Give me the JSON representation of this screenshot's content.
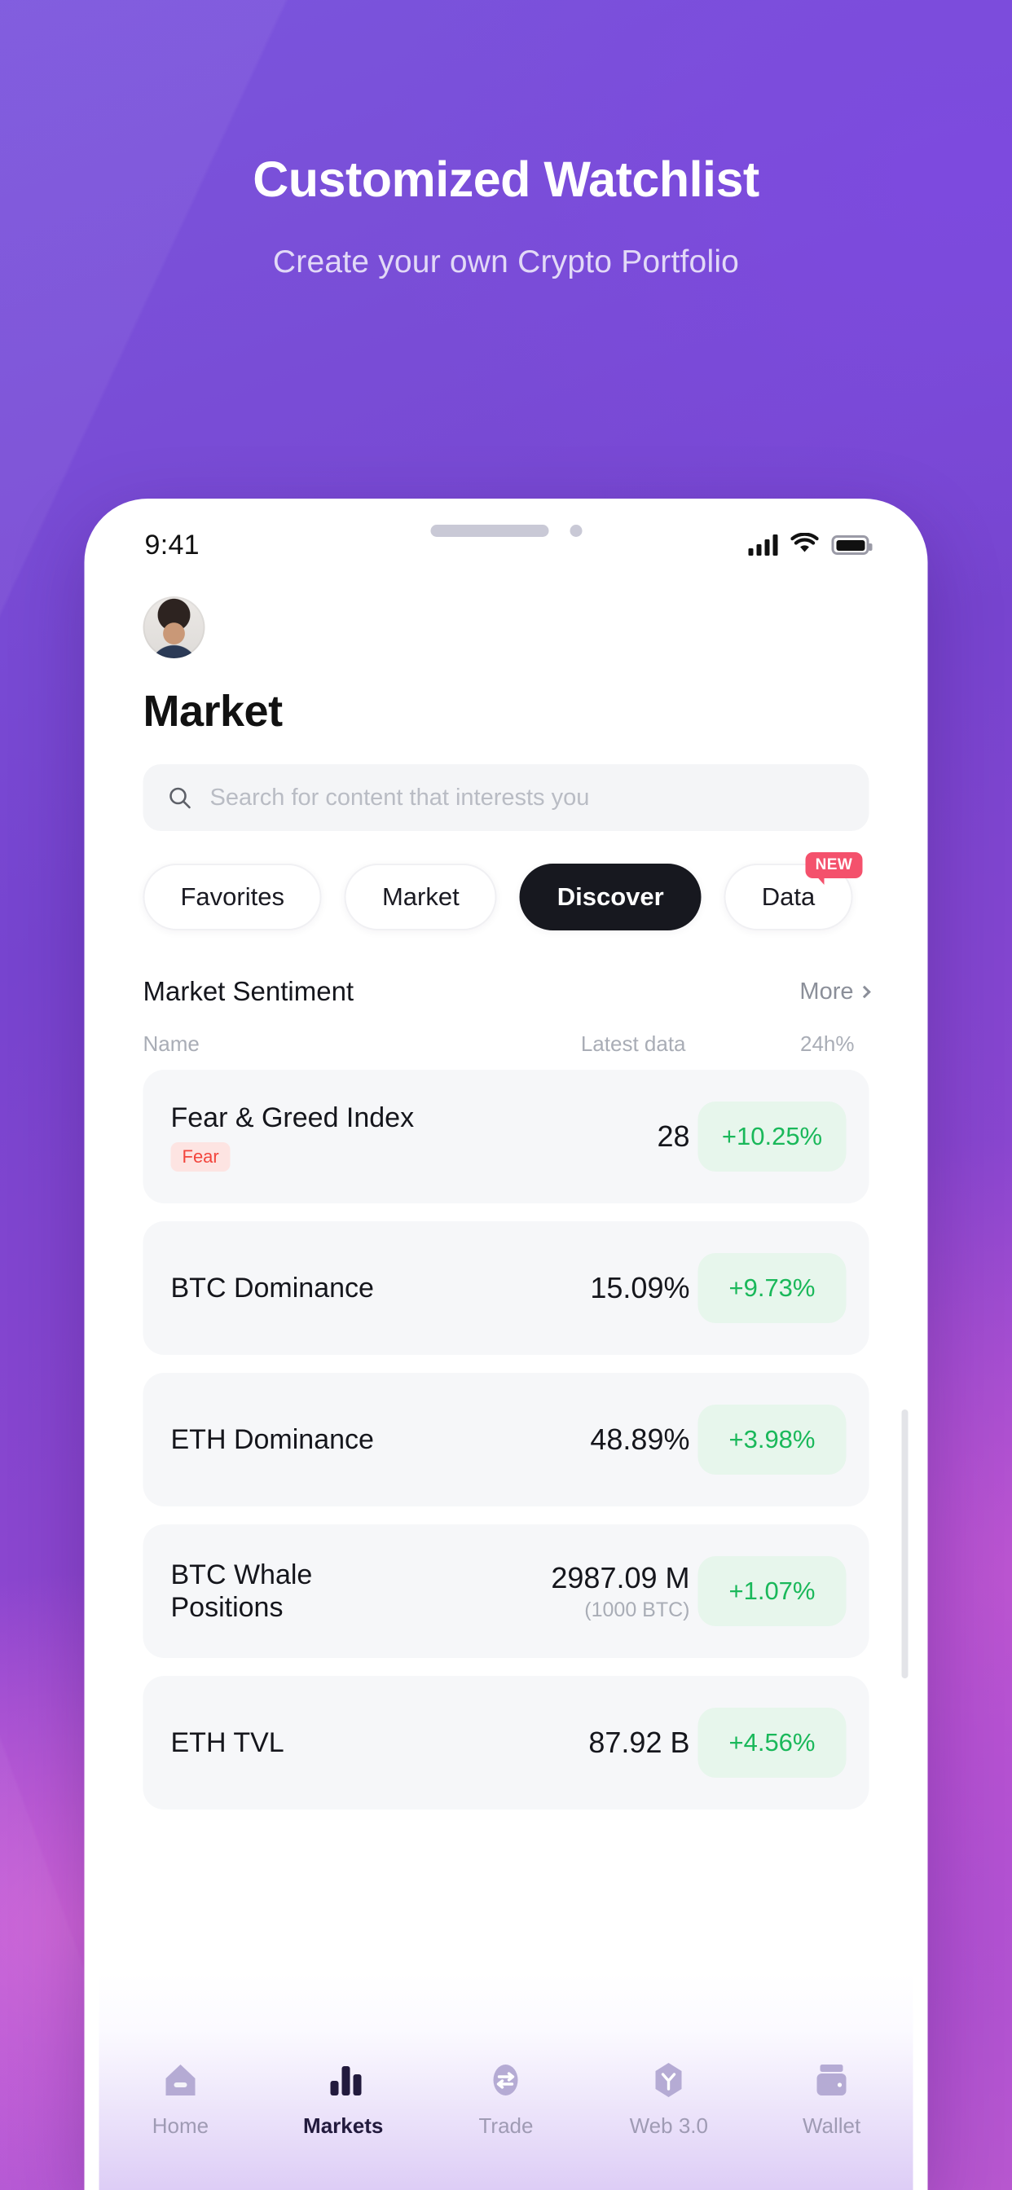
{
  "promo": {
    "title": "Customized Watchlist",
    "subtitle": "Create your own Crypto Portfolio"
  },
  "status_bar": {
    "time": "9:41",
    "icons": [
      "cellular-signal-icon",
      "wifi-icon",
      "battery-icon"
    ]
  },
  "app": {
    "avatar_alt": "user-avatar",
    "page_title": "Market",
    "search": {
      "placeholder": "Search for content that interests you",
      "icon": "search-icon"
    },
    "chips": [
      {
        "label": "Favorites",
        "active": false,
        "badge": ""
      },
      {
        "label": "Market",
        "active": false,
        "badge": ""
      },
      {
        "label": "Discover",
        "active": true,
        "badge": ""
      },
      {
        "label": "Data",
        "active": false,
        "badge": "NEW"
      }
    ],
    "section": {
      "title": "Market Sentiment",
      "more_label": "More",
      "more_icon": "chevron-right-icon"
    },
    "columns": {
      "name": "Name",
      "latest": "Latest data",
      "change": "24h%"
    },
    "rows": [
      {
        "name": "Fear & Greed Index",
        "tag": "Fear",
        "value": "28",
        "sub": "",
        "change": "+10.25%"
      },
      {
        "name": "BTC Dominance",
        "tag": "",
        "value": "15.09%",
        "sub": "",
        "change": "+9.73%"
      },
      {
        "name": "ETH Dominance",
        "tag": "",
        "value": "48.89%",
        "sub": "",
        "change": "+3.98%"
      },
      {
        "name": "BTC Whale Positions",
        "tag": "",
        "value": "2987.09 M",
        "sub": "(1000 BTC)",
        "change": "+1.07%"
      },
      {
        "name": "ETH TVL",
        "tag": "",
        "value": "87.92 B",
        "sub": "",
        "change": "+4.56%"
      }
    ],
    "tabbar": [
      {
        "label": "Home",
        "icon": "home-icon",
        "active": false
      },
      {
        "label": "Markets",
        "icon": "bar-chart-icon",
        "active": true
      },
      {
        "label": "Trade",
        "icon": "swap-icon",
        "active": false
      },
      {
        "label": "Web 3.0",
        "icon": "hexagon-y-icon",
        "active": false
      },
      {
        "label": "Wallet",
        "icon": "wallet-icon",
        "active": false
      }
    ]
  },
  "colors": {
    "accent_purple": "#7744cf",
    "positive_green": "#1ab85a",
    "positive_bg": "#e7f6ec",
    "fear_red": "#f2453d",
    "fear_bg": "#fde4e2",
    "badge_red": "#f4516c",
    "active_chip": "#17181f"
  }
}
